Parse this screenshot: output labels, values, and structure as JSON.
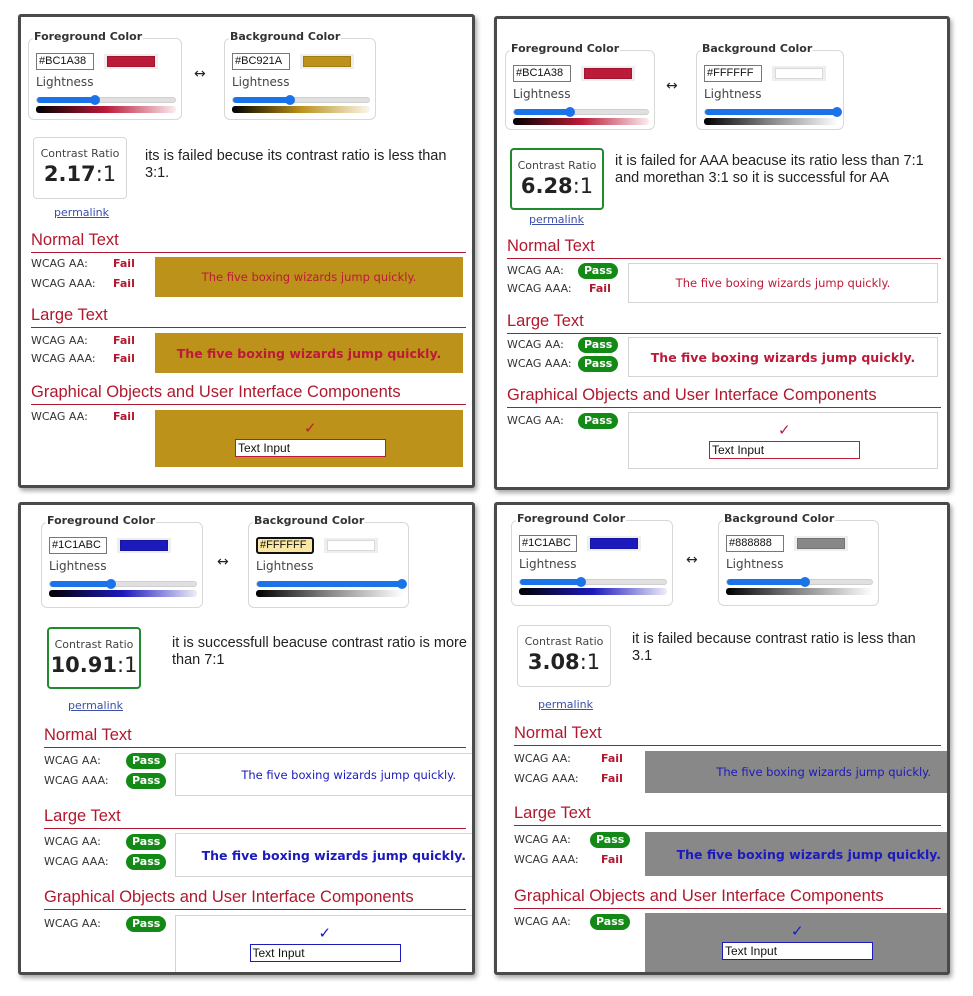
{
  "common": {
    "foreground_legend": "Foreground Color",
    "background_legend": "Background Color",
    "lightness_label": "Lightness",
    "swap_icon": "↔",
    "contrast_ratio_label": "Contrast Ratio",
    "ratio_suffix": ":1",
    "permalink": "permalink",
    "normal_text_title": "Normal Text",
    "large_text_title": "Large Text",
    "graphical_title": "Graphical Objects and User Interface Components",
    "wcag_aa_label": "WCAG AA:",
    "wcag_aaa_label": "WCAG AAA:",
    "sample_text": "The five boxing wizards jump quickly.",
    "check_icon": "✓",
    "text_input_value": "Text Input"
  },
  "panels": [
    {
      "foreground": {
        "hex": "#BC1A38",
        "color": "#BC1A38",
        "lightness": 0.42
      },
      "background": {
        "hex": "#BC921A",
        "color": "#BC921A",
        "lightness": 0.42
      },
      "ratio_value": "2.17",
      "ratio_status": "fail",
      "note": "its is failed becuse its contrast ratio is less than 3:1.",
      "normal": {
        "aa": "Fail",
        "aaa": "Fail"
      },
      "large": {
        "aa": "Fail",
        "aaa": "Fail"
      },
      "graphical": {
        "aa": "Fail"
      }
    },
    {
      "foreground": {
        "hex": "#BC1A38",
        "color": "#BC1A38",
        "lightness": 0.42
      },
      "background": {
        "hex": "#FFFFFF",
        "color": "#FFFFFF",
        "lightness": 1.0
      },
      "ratio_value": "6.28",
      "ratio_status": "pass",
      "note": "it is failed for AAA beacuse its ratio less than 7:1 and morethan 3:1 so it is successful for AA",
      "normal": {
        "aa": "Pass",
        "aaa": "Fail"
      },
      "large": {
        "aa": "Pass",
        "aaa": "Pass"
      },
      "graphical": {
        "aa": "Pass"
      }
    },
    {
      "foreground": {
        "hex": "#1C1ABC",
        "color": "#1C1ABC",
        "lightness": 0.42
      },
      "background": {
        "hex": "#FFFFFF",
        "color": "#FFFFFF",
        "lightness": 1.0,
        "focused": true
      },
      "ratio_value": "10.91",
      "ratio_status": "pass",
      "note": "it is successfull beacuse contrast ratio is more than 7:1",
      "normal": {
        "aa": "Pass",
        "aaa": "Pass"
      },
      "large": {
        "aa": "Pass",
        "aaa": "Pass"
      },
      "graphical": {
        "aa": "Pass"
      }
    },
    {
      "foreground": {
        "hex": "#1C1ABC",
        "color": "#1C1ABC",
        "lightness": 0.42
      },
      "background": {
        "hex": "#888888",
        "color": "#888888",
        "lightness": 0.54
      },
      "ratio_value": "3.08",
      "ratio_status": "neutral",
      "note": "it is failed because contrast ratio is less than 3.1",
      "normal": {
        "aa": "Fail",
        "aaa": "Fail"
      },
      "large": {
        "aa": "Pass",
        "aaa": "Fail"
      },
      "graphical": {
        "aa": "Pass"
      }
    }
  ],
  "colors": {
    "pass_green": "#138A16",
    "fail_red": "#B0182E",
    "slider_blue": "#1A73E8",
    "section_red": "#B0182E"
  }
}
